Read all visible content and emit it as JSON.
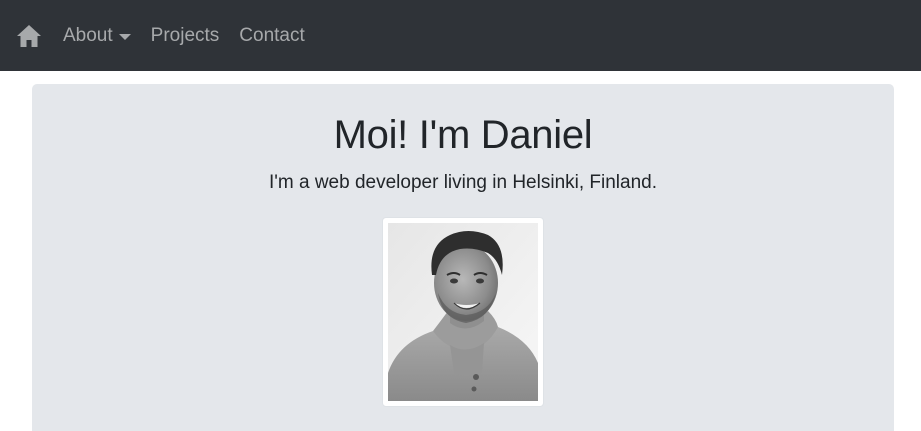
{
  "nav": {
    "home_icon": "home-icon",
    "items": [
      {
        "label": "About",
        "has_dropdown": true
      },
      {
        "label": "Projects"
      },
      {
        "label": "Contact"
      }
    ]
  },
  "hero": {
    "title": "Moi! I'm Daniel",
    "subtitle": "I'm a web developer living in Helsinki, Finland."
  },
  "profile_photo": {
    "description": "grayscale-portrait"
  },
  "colors": {
    "navbar_bg": "#2f3338",
    "nav_text": "#a7a9ab",
    "jumbotron_bg": "#e4e7eb",
    "text": "#212529"
  }
}
